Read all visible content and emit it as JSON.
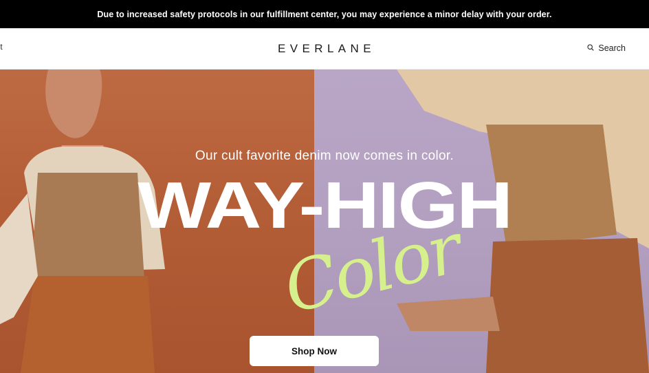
{
  "banner": {
    "text": "Due to increased safety protocols in our fulfillment center, you may experience a minor delay with your order."
  },
  "nav": {
    "left_link": "ut",
    "logo": "EVERLANE",
    "search_label": "Search",
    "search_icon": "search-icon"
  },
  "hero": {
    "subtitle": "Our cult favorite denim now comes in color.",
    "headline": "WAY-HIGH",
    "script": "Color",
    "cta": "Shop Now"
  },
  "colors": {
    "banner_bg": "#000000",
    "left_panel": "#b55f38",
    "right_panel": "#b3a0c0",
    "script_green": "#d7f08e"
  }
}
